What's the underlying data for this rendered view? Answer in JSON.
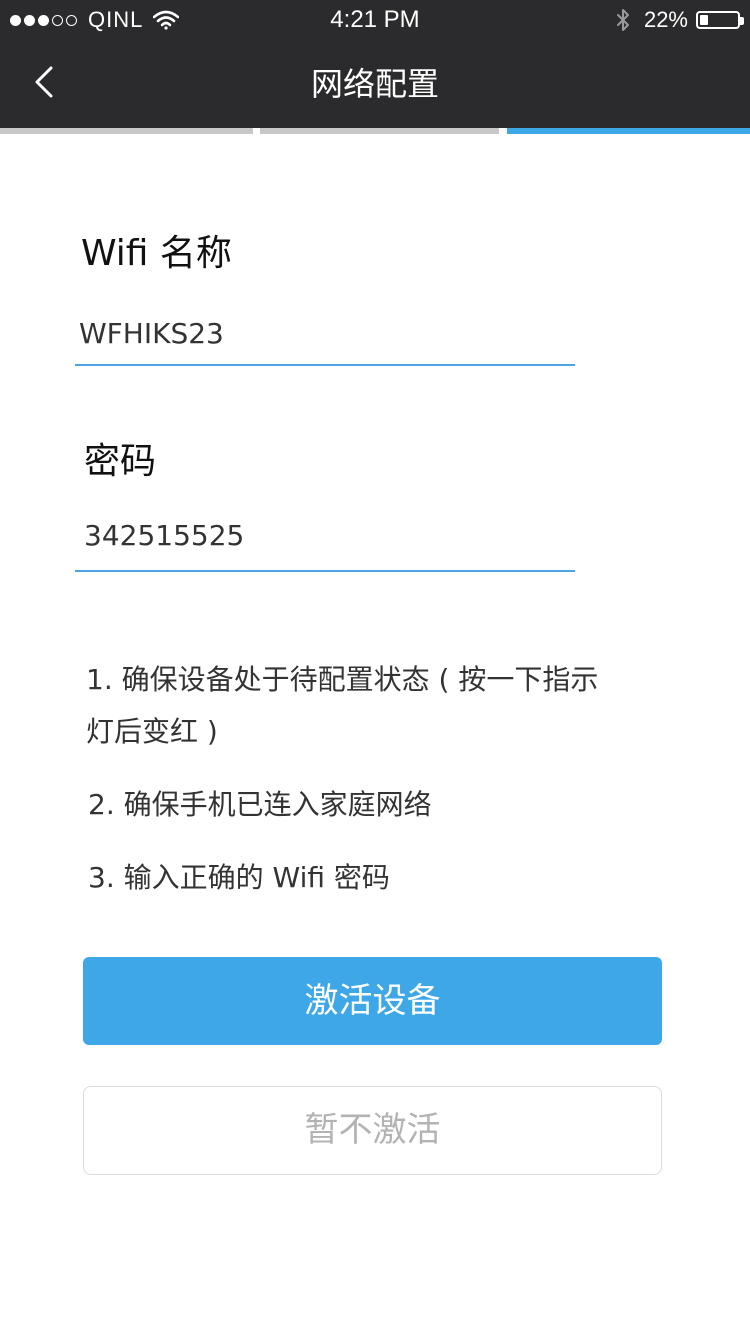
{
  "status_bar": {
    "carrier": "QINL",
    "time": "4:21 PM",
    "battery_percent": "22%",
    "battery_level": 0.22,
    "signal_bars_filled": 3,
    "signal_bars_total": 5,
    "icons": [
      "wifi-icon",
      "bluetooth-icon",
      "battery-icon"
    ]
  },
  "nav": {
    "title": "网络配置",
    "back_icon": "chevron-left-icon"
  },
  "progress": {
    "total_steps": 3,
    "current_step": 3,
    "active_color": "#3ea7e8",
    "inactive_color": "#c8c8c8"
  },
  "form": {
    "ssid_label": "Wifi 名称",
    "ssid_value": "WFHIKS23",
    "password_label": "密码",
    "password_value": "342515525",
    "underline_color": "#4ba2e4"
  },
  "tips": {
    "tip1_line1": "1. 确保设备处于待配置状态 ( 按一下指示",
    "tip1_line2": "灯后变红 )",
    "tip2": "2. 确保手机已连入家庭网络",
    "tip3": "3. 输入正确的 Wifi 密码"
  },
  "actions": {
    "activate_label": "激活设备",
    "skip_label": "暂不激活",
    "primary_color": "#3ea7e8"
  }
}
